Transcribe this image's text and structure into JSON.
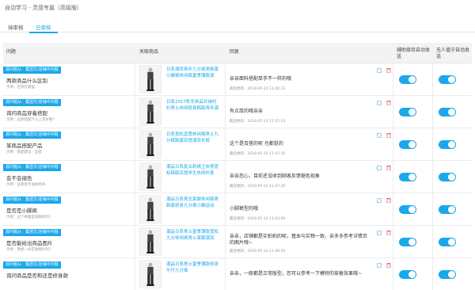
{
  "breadcrumb": "自动学习 - 灵感专属（高级版）",
  "tabs": [
    {
      "label": "待审核",
      "active": false
    },
    {
      "label": "已审核",
      "active": true
    }
  ],
  "columns": {
    "question": "问题",
    "product": "关联商品",
    "reply": "回复",
    "assist": "辅助接待自动发送",
    "unmanned": "无人值守自动发送"
  },
  "rows": [
    {
      "tag": "源问题从：集团文/店铺中问题",
      "title": "两款商品什么区别",
      "sub": "示例：区别在哪里",
      "product": "日系潮流青年九分裤男韩版小脚裤休闲裤夏季薄款潮",
      "reply": "亲亲面料搭配单手不一样的哦",
      "time": "最后更新：2018-05-10 11:40:23",
      "assist": true,
      "unmanned": true
    },
    {
      "tag": "源问题从：集团文/店铺中问题",
      "title": "询问商品穿着搭配",
      "sub": "示例：这款搭配什么上衣好看？",
      "product": "日系2017秋冬新品长袖衬衫男士休闲修身韩版青年潮",
      "reply": "有点厚的哦亲亲",
      "time": "最后更新：2018-05-10 11:47:23",
      "assist": true,
      "unmanned": true
    },
    {
      "tag": "源问题从：集团文/店铺中问题",
      "title": "某商品搭配产品",
      "sub": "示例：搭配建议 · 宜搭",
      "product": "日系宽松直筒休闲裤男士九分裤韩版百搭潮流长裤",
      "reply": "这个是百搭的呢 也都挺的",
      "time": "最后更新：2018-05-10 11:47:20",
      "assist": true,
      "unmanned": true
    },
    {
      "tag": "源问题从：集团文/店铺中问题",
      "title": "会不会褪色",
      "sub": "示例：这款会不会掉色吗",
      "product": "潮品日系复古刺绣卫衣男宽松韩版百搭学生休闲外套",
      "reply": "亲亲您心，目前还没收到顾客反馈褪色现象",
      "time": "最后更新：2018-05-10 11:47:30",
      "assist": true,
      "unmanned": true
    },
    {
      "tag": "源问题从：集团文/店铺中问题",
      "title": "是否是小脚裤",
      "sub": "示例：这个裤腿是束脚的吗？",
      "product": "潮品日系男式束脚休闲裤男韩版修身九分裤小脚运动",
      "reply": "小脚裤型的哦",
      "time": "最后更新：2018-05-10 11:43:09",
      "assist": true,
      "unmanned": true
    },
    {
      "tag": "源问题从：集团文/店铺中问题",
      "title": "是否能给出商品图片",
      "sub": "示例：我想一份实拍图片吗？",
      "product": "潮品日系男士夏季薄款宽松九分休闲裤男士束脚潮流",
      "reply": "亲亲，店铺都是实拍拍的呢，基本与实物一致，亲多多参考详情页的图片哦~",
      "time": "最后更新：2018-05-10 11:48:50",
      "assist": true,
      "unmanned": true
    },
    {
      "tag": "源问题从：集团文/店铺中问题",
      "title": "询问商品是否和还是修身款",
      "sub": "",
      "product": "潮品日系男士夏季薄款修身牛仔九分裤",
      "reply": "亲亲，一般都是正常版型，您可以参考一下模特的穿着效果哦~",
      "time": "",
      "assist": true,
      "unmanned": true
    }
  ],
  "colors": {
    "accent": "#1aa7ec",
    "header_bg": "#f2f3f5"
  },
  "icons": {
    "copy": "copy-icon",
    "delete": "trash-icon"
  }
}
